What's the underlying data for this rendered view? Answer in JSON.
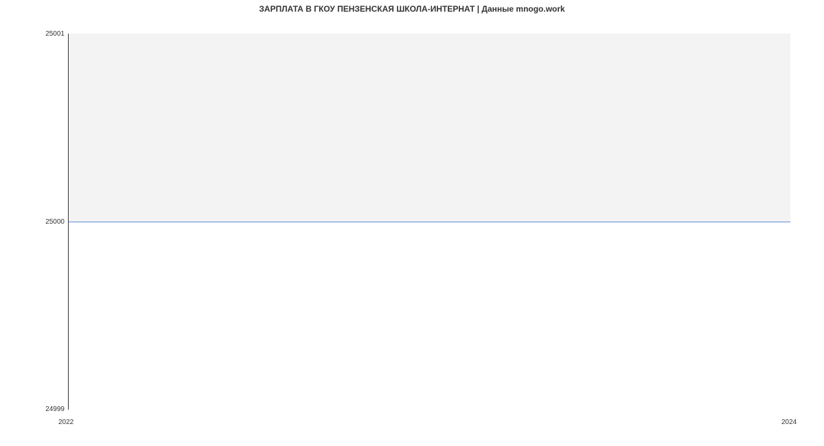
{
  "chart_data": {
    "type": "line",
    "title": "ЗАРПЛАТА В ГКОУ ПЕНЗЕНСКАЯ ШКОЛА-ИНТЕРНАТ | Данные mnogo.work",
    "xlabel": "",
    "ylabel": "",
    "x": [
      2022,
      2024
    ],
    "values": [
      25000,
      25000
    ],
    "xlim": [
      2022,
      2024
    ],
    "ylim": [
      24999,
      25001
    ],
    "y_ticks": [
      24999,
      25000,
      25001
    ],
    "x_ticks": [
      2022,
      2024
    ]
  },
  "labels": {
    "y_25001": "25001",
    "y_25000": "25000",
    "y_24999": "24999",
    "x_2022": "2022",
    "x_2024": "2024"
  }
}
